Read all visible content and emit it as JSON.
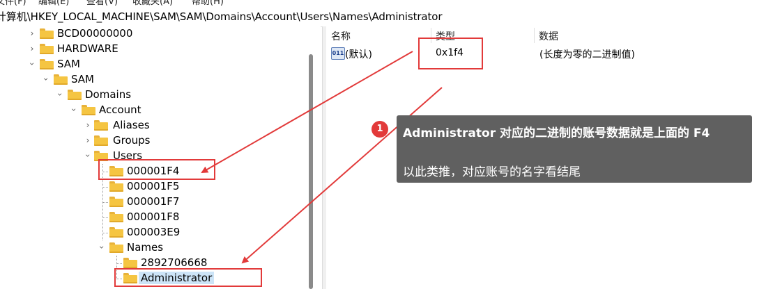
{
  "menu": [
    "文件(F)",
    "编辑(E)",
    "查看(V)",
    "收藏夹(A)",
    "帮助(H)"
  ],
  "address": "计算机\\HKEY_LOCAL_MACHINE\\SAM\\SAM\\Domains\\Account\\Users\\Names\\Administrator",
  "tree": {
    "nodes": [
      {
        "label": "BCD00000000",
        "expanded": false
      },
      {
        "label": "HARDWARE",
        "expanded": false
      },
      {
        "label": "SAM",
        "expanded": true
      },
      {
        "label": "SAM",
        "expanded": true
      },
      {
        "label": "Domains",
        "expanded": true
      },
      {
        "label": "Account",
        "expanded": true
      },
      {
        "label": "Aliases",
        "expanded": false
      },
      {
        "label": "Groups",
        "expanded": false
      },
      {
        "label": "Users",
        "expanded": true
      },
      {
        "label": "000001F4"
      },
      {
        "label": "000001F5"
      },
      {
        "label": "000001F7"
      },
      {
        "label": "000001F8"
      },
      {
        "label": "000003E9"
      },
      {
        "label": "Names",
        "expanded": true
      },
      {
        "label": "2892706668"
      },
      {
        "label": "Administrator",
        "selected": true
      }
    ]
  },
  "list": {
    "headers": {
      "name": "名称",
      "type": "类型",
      "data": "数据"
    },
    "rows": [
      {
        "icon": "binary-value-icon",
        "icon_text": "011\n110",
        "name": "(默认)",
        "type": "0x1f4",
        "data": "(长度为零的二进制值)"
      }
    ]
  },
  "annotation": {
    "badge": "1",
    "line1": "Administrator 对应的二进制的账号数据就是上面的 F4",
    "line2": "以此类推，对应账号的名字看结尾"
  },
  "colors": {
    "highlight": "#e23a3a",
    "callout_bg": "#606060",
    "selection": "#cce4f7",
    "folder": "#f5c542"
  }
}
